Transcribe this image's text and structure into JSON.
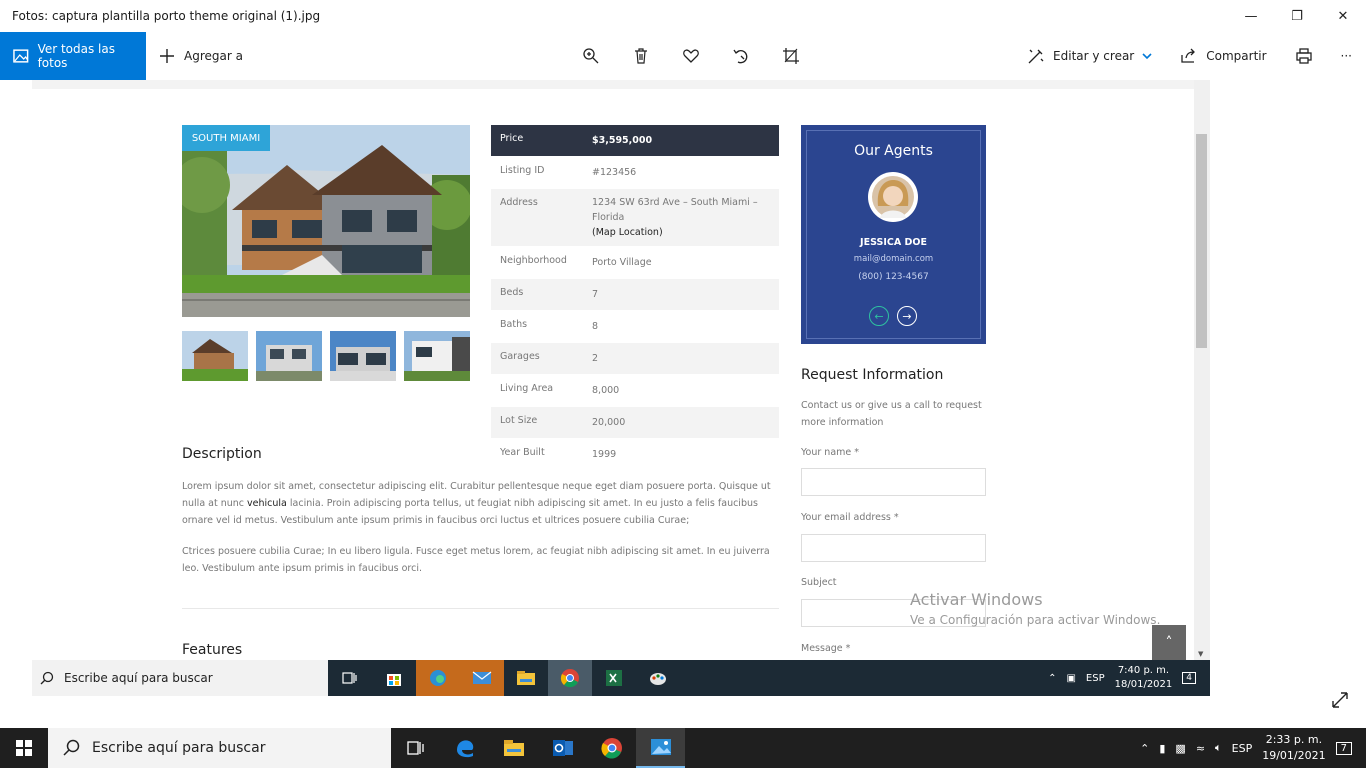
{
  "window": {
    "title": "Fotos: captura plantilla porto theme original (1).jpg",
    "minimize": "—",
    "maximize": "❐",
    "close": "✕"
  },
  "toolbar": {
    "view_all": "Ver todas las fotos",
    "add_to": "Agregar a",
    "edit_create": "Editar y crear",
    "share": "Compartir",
    "more": "···"
  },
  "listing": {
    "badge": "SOUTH MIAMI",
    "specs": [
      {
        "key": "Price",
        "value": "$3,595,000"
      },
      {
        "key": "Listing ID",
        "value": "#123456"
      },
      {
        "key": "Address",
        "value": "1234 SW 63rd Ave – South Miami – Florida",
        "extra": "(Map Location)"
      },
      {
        "key": "Neighborhood",
        "value": "Porto Village"
      },
      {
        "key": "Beds",
        "value": "7"
      },
      {
        "key": "Baths",
        "value": "8"
      },
      {
        "key": "Garages",
        "value": "2"
      },
      {
        "key": "Living Area",
        "value": "8,000"
      },
      {
        "key": "Lot Size",
        "value": "20,000"
      },
      {
        "key": "Year Built",
        "value": "1999"
      }
    ],
    "agents": {
      "heading": "Our Agents",
      "name": "JESSICA DOE",
      "email": "mail@domain.com",
      "phone": "(800) 123-4567",
      "prev": "←",
      "next": "→"
    },
    "request": {
      "title": "Request Information",
      "subtitle": "Contact us or give us a call to request more information",
      "name_label": "Your name *",
      "email_label": "Your email address *",
      "subject_label": "Subject",
      "message_label": "Message *"
    },
    "description": {
      "title": "Description",
      "p1_a": "Lorem ipsum dolor sit amet, consectetur adipiscing elit. Curabitur pellentesque neque eget diam posuere porta. Quisque ut nulla at nunc ",
      "p1_bold": "vehicula",
      "p1_b": " lacinia. Proin adipiscing porta tellus, ut feugiat nibh adipiscing sit amet. In eu justo a felis faucibus ornare vel id metus. Vestibulum ante ipsum primis in faucibus orci luctus et ultrices posuere cubilia Curae;",
      "p2": "Ctrices posuere cubilia Curae; In eu libero ligula. Fusce eget metus lorem, ac feugiat nibh adipiscing sit amet. In eu juiverra leo. Vestibulum ante ipsum primis in faucibus orci."
    },
    "features_title": "Features",
    "to_top": "˄"
  },
  "watermark": {
    "line1": "Activar Windows",
    "line2": "Ve a Configuración para activar Windows."
  },
  "inner_taskbar": {
    "search_placeholder": "Escribe aquí para buscar",
    "lang": "ESP",
    "time": "7:40 p. m.",
    "date": "18/01/2021",
    "notif_count": "4"
  },
  "taskbar": {
    "search_placeholder": "Escribe aquí para buscar",
    "lang": "ESP",
    "time": "2:33 p. m.",
    "date": "19/01/2021",
    "notif_count": "7"
  }
}
